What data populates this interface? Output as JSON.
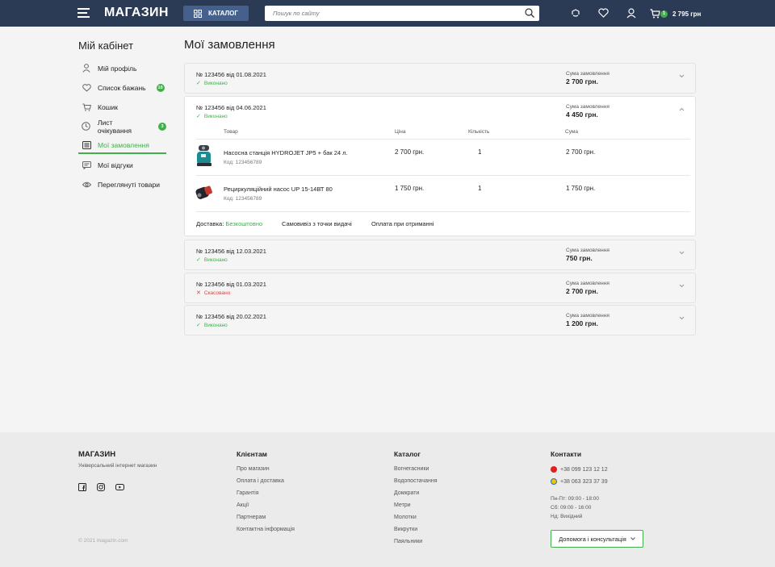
{
  "header": {
    "logo": "МАГАЗИН",
    "catalog_label": "КАТАЛОГ",
    "search_placeholder": "Пошук по сайту",
    "cart_count": "1",
    "cart_sum": "2 795 грн"
  },
  "sidebar": {
    "title": "Мій кабінет",
    "items": [
      {
        "label": "Мій профіль",
        "icon": "user-icon"
      },
      {
        "label": "Список бажань",
        "icon": "heart-icon",
        "badge": "10"
      },
      {
        "label": "Кошик",
        "icon": "cart-icon"
      },
      {
        "label": "Лист очікування",
        "icon": "clock-icon",
        "badge": "3"
      },
      {
        "label": "Мої замовлення",
        "icon": "orders-icon",
        "active": true
      },
      {
        "label": "Мої відгуки",
        "icon": "reviews-icon"
      },
      {
        "label": "Переглянуті товари",
        "icon": "eye-icon"
      }
    ]
  },
  "main": {
    "title": "Мої замовлення",
    "sum_label": "Сума замовлення",
    "orders": [
      {
        "number": "№ 123456 від 01.08.2021",
        "status": "Виконано",
        "sum": "2 700 грн."
      },
      {
        "number": "№ 123456 від 04.06.2021",
        "status": "Виконано",
        "sum": "4 450 грн."
      },
      {
        "number": "№ 123456 від 12.03.2021",
        "status": "Виконано",
        "sum": "750 грн."
      },
      {
        "number": "№ 123456 від 01.03.2021",
        "status": "Скасовано",
        "sum": "2 700 грн."
      },
      {
        "number": "№ 123456 від 20.02.2021",
        "status": "Виконано",
        "sum": "1 200 грн."
      }
    ],
    "table_headers": {
      "product": "Товар",
      "price": "Ціна",
      "qty": "Кількість",
      "sum": "Сума"
    },
    "products": [
      {
        "name": "Насосна станція HYDROJET JP5 + бак 24 л.",
        "code": "Код: 123456789",
        "price": "2 700 грн.",
        "qty": "1",
        "sum": "2 700 грн."
      },
      {
        "name": "Рециркуляційний насос UP 15-14ВТ 80",
        "code": "Код: 123456789",
        "price": "1 750 грн.",
        "qty": "1",
        "sum": "1 750 грн."
      }
    ],
    "delivery_label": "Доставка:",
    "delivery_value": "Безкоштовно",
    "pickup": "Самовивіз з точки видачі",
    "payment": "Оплата при отриманні"
  },
  "footer": {
    "logo": "МАГАЗИН",
    "subtitle": "Універсальний інтернет магазин",
    "copyright": "© 2021 magazin.com",
    "clients_title": "Клієнтам",
    "clients_links": [
      "Про магазин",
      "Оплата і доставка",
      "Гарантія",
      "Акції",
      "Партнерам",
      "Контактна інформація"
    ],
    "catalog_title": "Каталог",
    "catalog_links": [
      "Вогнегасники",
      "Водопостачання",
      "Домкрати",
      "Метри",
      "Молотки",
      "Викрутки",
      "Паяльники"
    ],
    "contacts_title": "Контакти",
    "phones": [
      "+38 099 123 12 12",
      "+38 063 323 37 39"
    ],
    "hours": [
      "Пн-Пт: 09:00 - 18:00",
      "Сб: 09:00 - 16:00",
      "Нд: Вихідний"
    ],
    "help_button": "Допомога і консультація"
  },
  "colors": {
    "header_bg": "#2b3a55",
    "accent_green": "#3fb04a",
    "cancel_red": "#e04040",
    "catalog_btn": "#46608e"
  }
}
